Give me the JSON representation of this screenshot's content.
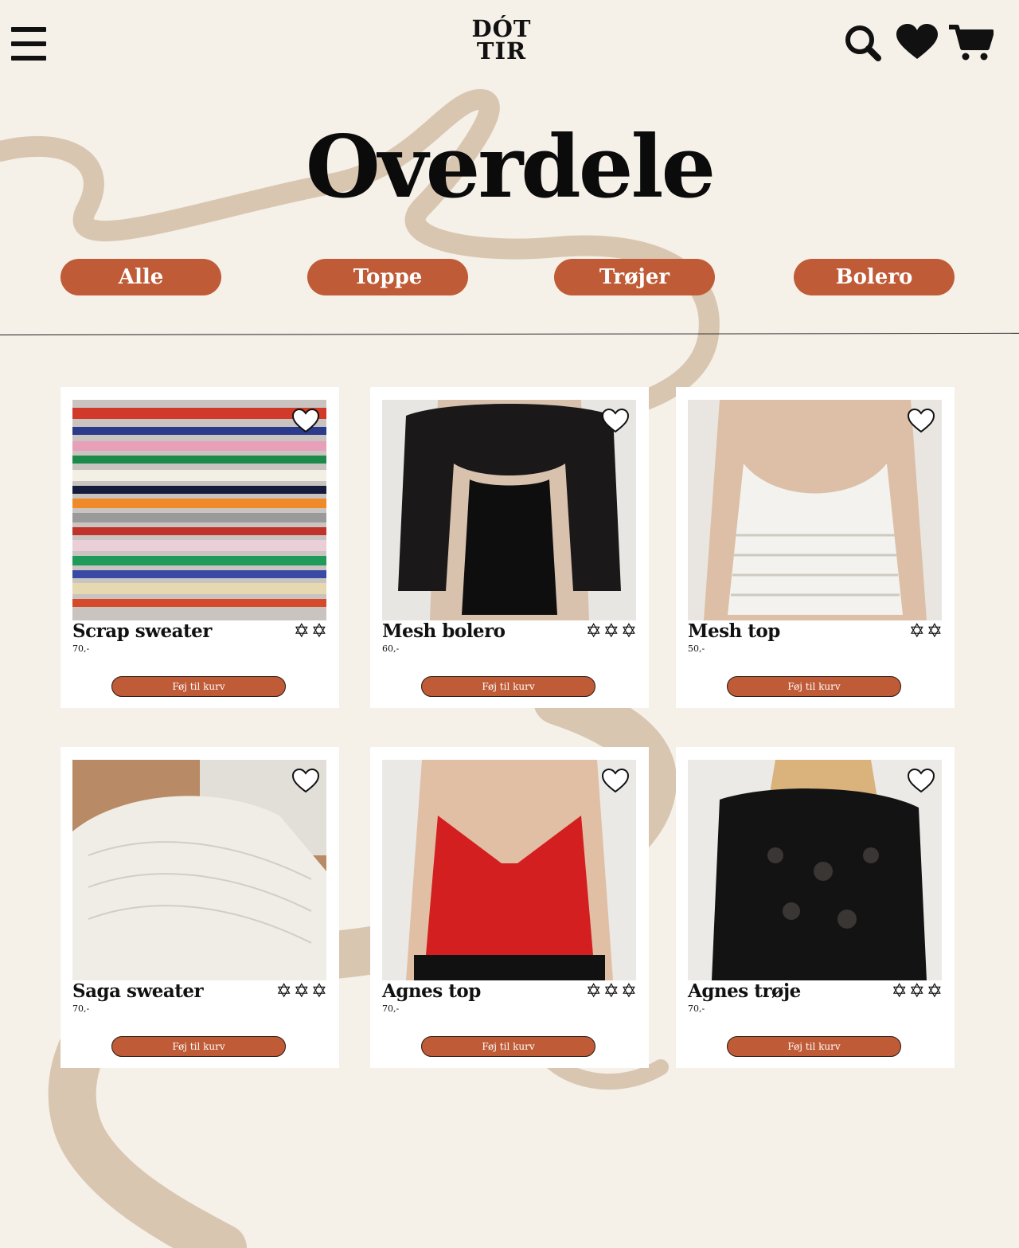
{
  "header": {
    "logo_line1": "DÓT",
    "logo_line2": "TIR"
  },
  "page": {
    "title": "Overdele"
  },
  "filters": [
    {
      "label": "Alle"
    },
    {
      "label": "Toppe"
    },
    {
      "label": "Trøjer"
    },
    {
      "label": "Bolero"
    }
  ],
  "colors": {
    "background": "#f5f0e8",
    "accent": "#bf5b36",
    "swirl": "#d8c6b0",
    "text": "#0b0b0b"
  },
  "icons": {
    "menu": "hamburger-menu-icon",
    "search": "search-icon",
    "wishlist": "heart-icon",
    "cart": "cart-icon",
    "favorite": "heart-outline-icon",
    "rating": "six-point-star-icon"
  },
  "products": [
    {
      "name": "Scrap sweater",
      "price": "70,-",
      "stars": 2,
      "button": "Føj til kurv"
    },
    {
      "name": "Mesh bolero",
      "price": "60,-",
      "stars": 3,
      "button": "Føj til kurv"
    },
    {
      "name": "Mesh top",
      "price": "50,-",
      "stars": 2,
      "button": "Føj til kurv"
    },
    {
      "name": "Saga sweater",
      "price": "70,-",
      "stars": 3,
      "button": "Føj til kurv"
    },
    {
      "name": "Agnes top",
      "price": "70,-",
      "stars": 3,
      "button": "Føj til kurv"
    },
    {
      "name": "Agnes trøje",
      "price": "70,-",
      "stars": 3,
      "button": "Føj til kurv"
    }
  ]
}
